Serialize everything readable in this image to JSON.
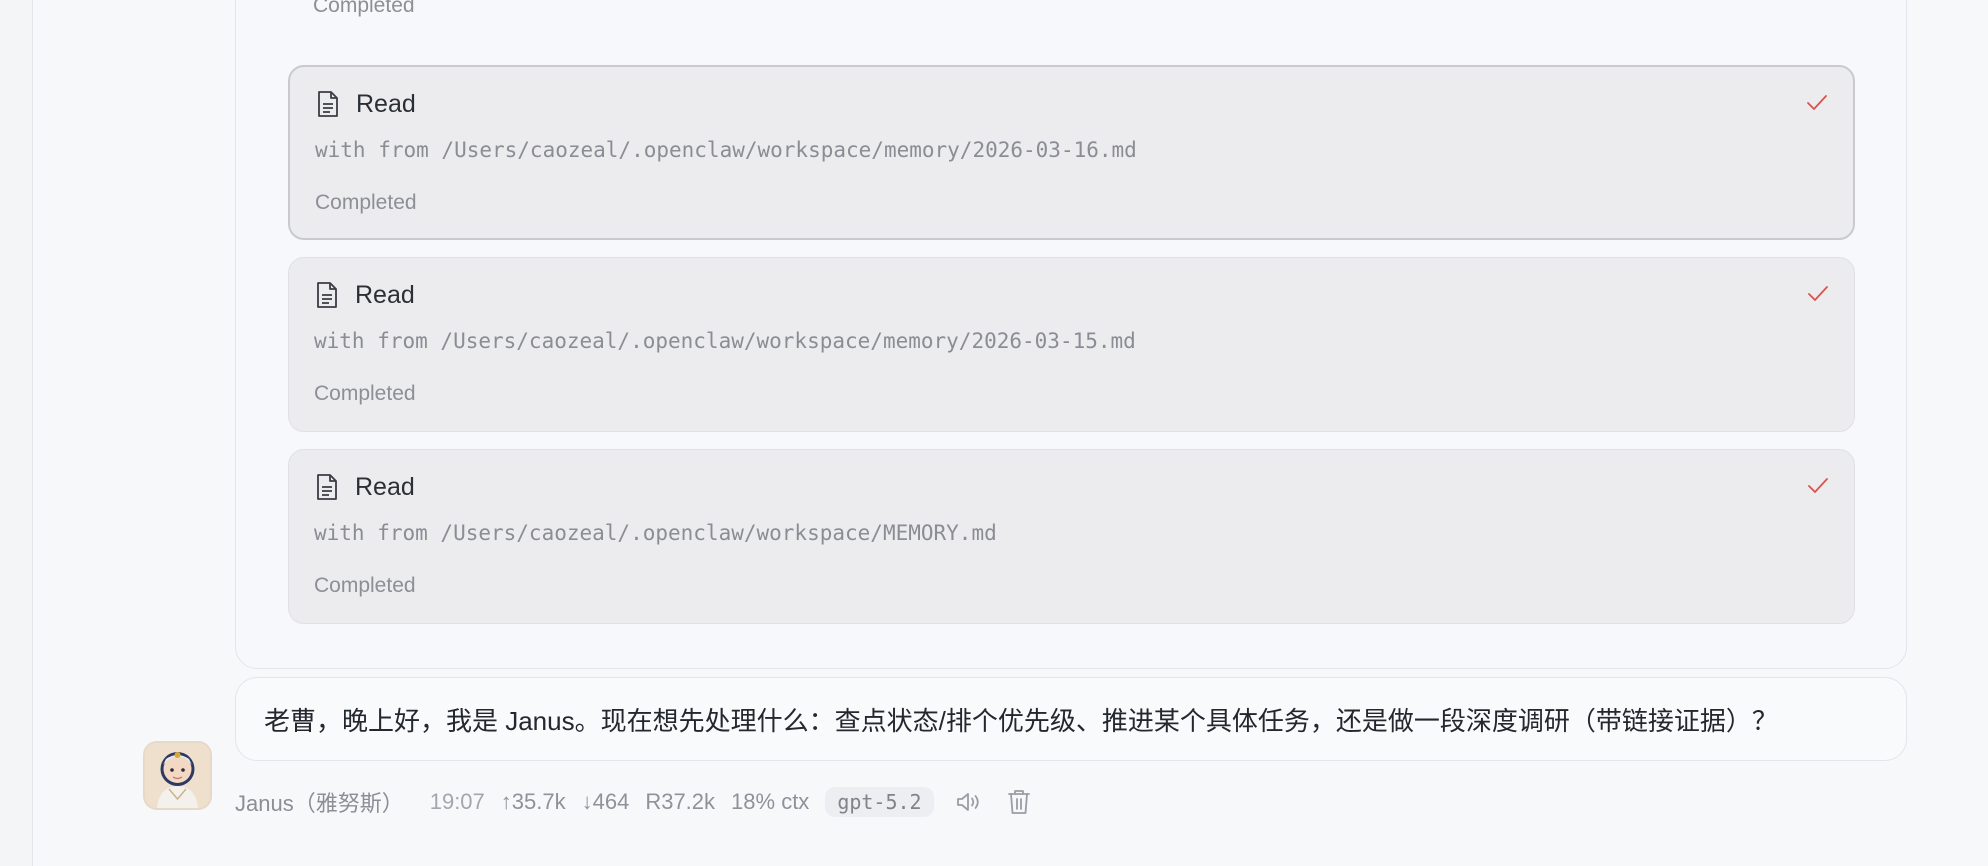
{
  "tool_group": {
    "partial_card": {
      "status": "Completed"
    },
    "cards": [
      {
        "title": "Read",
        "detail": "with from /Users/caozeal/.openclaw/workspace/memory/2026-03-16.md",
        "status": "Completed",
        "icon": "document-icon",
        "status_icon": "check-icon"
      },
      {
        "title": "Read",
        "detail": "with from /Users/caozeal/.openclaw/workspace/memory/2026-03-15.md",
        "status": "Completed",
        "icon": "document-icon",
        "status_icon": "check-icon"
      },
      {
        "title": "Read",
        "detail": "with from /Users/caozeal/.openclaw/workspace/MEMORY.md",
        "status": "Completed",
        "icon": "document-icon",
        "status_icon": "check-icon"
      }
    ]
  },
  "message": {
    "text": "老曹，晚上好，我是 Janus。现在想先处理什么：查点状态/排个优先级、推进某个具体任务，还是做一段深度调研（带链接证据）？",
    "sender": "Janus（雅努斯）",
    "time": "19:07",
    "input_tokens": "↑35.7k",
    "output_tokens": "↓464",
    "cache_read": "R37.2k",
    "context": "18% ctx",
    "model": "gpt-5.2",
    "actions": [
      "speaker-icon",
      "trash-icon"
    ]
  },
  "colors": {
    "check": "#d9534f",
    "card_bg": "#ececef",
    "page_bg": "#f7f8fa"
  }
}
